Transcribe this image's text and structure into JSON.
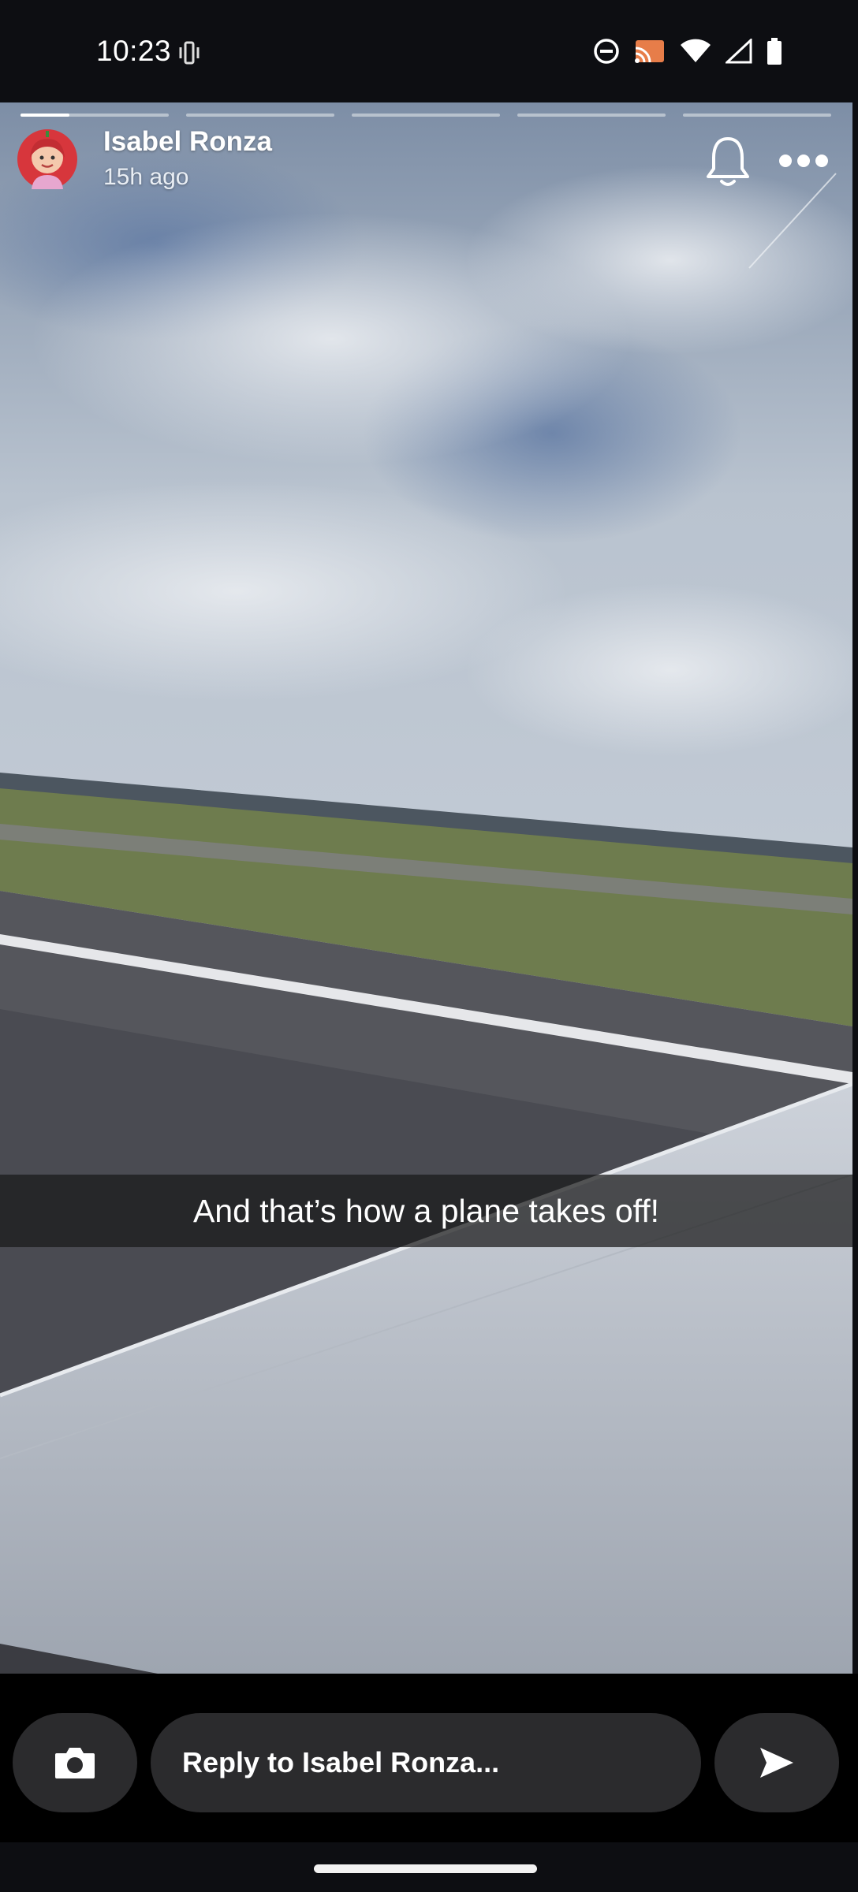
{
  "status_bar": {
    "time": "10:23",
    "icons": [
      "vibrate-icon",
      "do-not-disturb-icon",
      "cast-icon",
      "wifi-icon",
      "cell-signal-icon",
      "battery-icon"
    ]
  },
  "story": {
    "progress": {
      "segments": 5,
      "current_segment": 1,
      "current_fraction": 0.33
    },
    "user": {
      "name": "Isabel Ronza",
      "posted": "15h ago"
    },
    "caption": "And that’s how a plane takes off!",
    "icons": [
      "bell-icon",
      "more-options-icon"
    ]
  },
  "reply_bar": {
    "placeholder": "Reply to Isabel Ronza...",
    "icons": [
      "camera-icon",
      "send-icon"
    ]
  }
}
